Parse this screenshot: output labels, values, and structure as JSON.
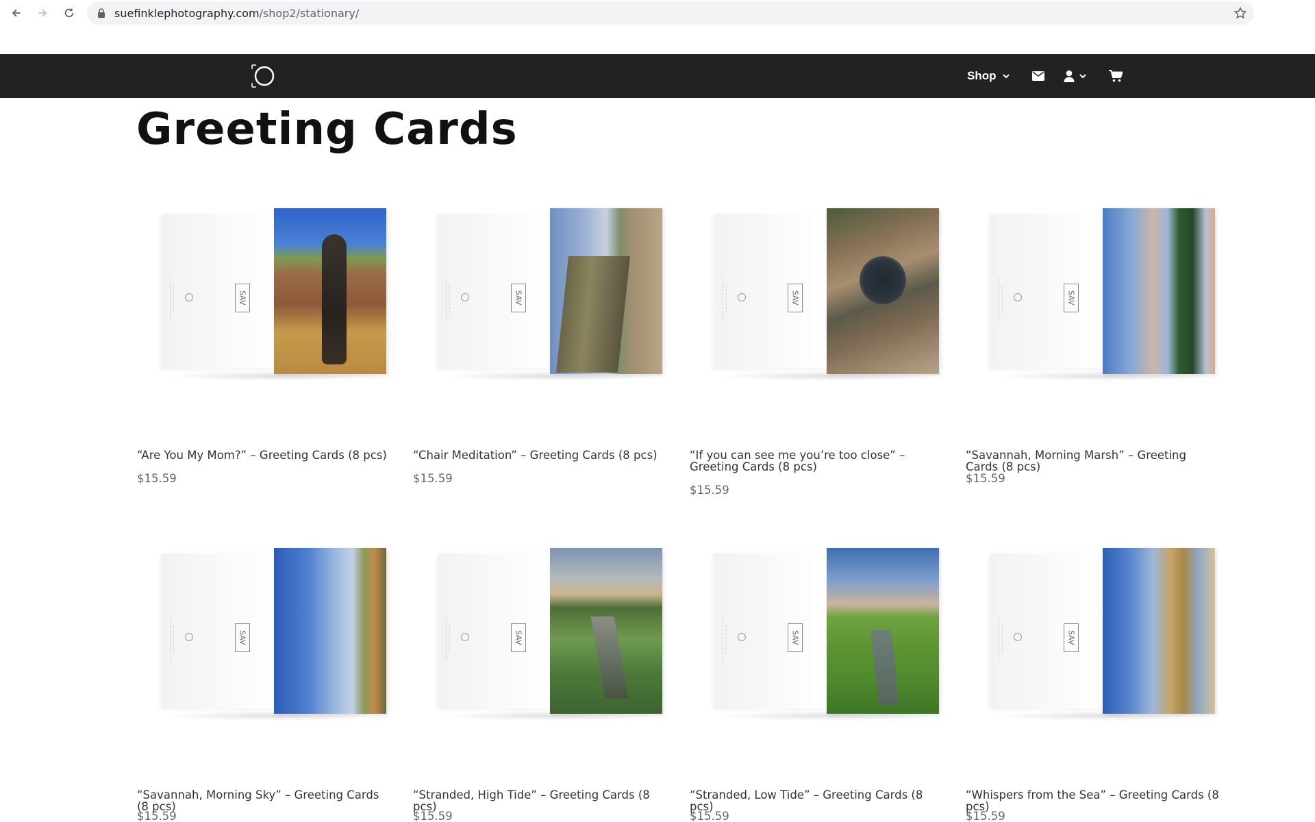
{
  "browser": {
    "url_domain": "suefinklephotography.com",
    "url_path": "/shop2/stationary/"
  },
  "header": {
    "menu_shop": "Shop",
    "icons": [
      "logo-circle-icon",
      "chevron-down-icon",
      "mail-icon",
      "user-icon",
      "cart-icon"
    ]
  },
  "page": {
    "title": "Greeting Cards"
  },
  "products": [
    {
      "name": "“Are You My Mom?” – Greeting Cards (8 pcs)",
      "price": "$15.59"
    },
    {
      "name": "“Chair Meditation” – Greeting Cards (8 pcs)",
      "price": "$15.59"
    },
    {
      "name": "“If you can see me you’re too close” – Greeting Cards (8 pcs)",
      "price": "$15.59"
    },
    {
      "name": "“Savannah, Morning Marsh” – Greeting Cards (8 pcs)",
      "price": "$15.59"
    },
    {
      "name": "“Savannah, Morning Sky” – Greeting Cards (8 pcs)",
      "price": "$15.59"
    },
    {
      "name": "“Stranded, High Tide” – Greeting Cards (8 pcs)",
      "price": "$15.59"
    },
    {
      "name": "“Stranded, Low Tide” – Greeting Cards (8 pcs)",
      "price": "$15.59"
    },
    {
      "name": "“Whispers from the Sea” – Greeting Cards (8 pcs)",
      "price": "$15.59"
    }
  ]
}
